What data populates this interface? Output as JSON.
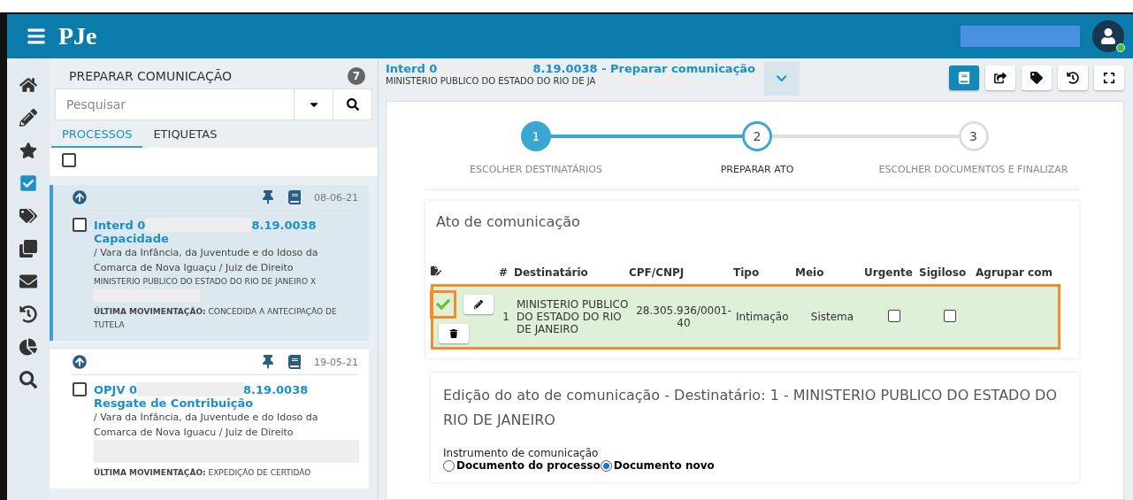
{
  "header": {
    "logo": "PJe"
  },
  "rail": [
    {
      "kind": "home",
      "selected": false
    },
    {
      "kind": "pencil",
      "selected": false
    },
    {
      "kind": "star",
      "selected": false
    },
    {
      "kind": "check",
      "selected": true
    },
    {
      "kind": "tags",
      "selected": false
    },
    {
      "kind": "copy",
      "selected": false
    },
    {
      "kind": "mail",
      "selected": false
    },
    {
      "kind": "history",
      "selected": false
    },
    {
      "kind": "pie",
      "selected": false
    },
    {
      "kind": "search",
      "selected": false
    }
  ],
  "panel": {
    "title": "PREPARAR COMUNICAÇÃO",
    "count": "7",
    "search": {
      "placeholder": "Pesquisar"
    },
    "tabs": [
      {
        "label": "PROCESSOS",
        "selected": true
      },
      {
        "label": "ETIQUETAS",
        "selected": false
      }
    ],
    "select_all_checked": false,
    "cards": [
      {
        "selected": true,
        "checked": false,
        "date": "08-06-21",
        "number_start": "Interd 0",
        "number_end": "8.19.0038",
        "subject": "Capacidade",
        "court": "/ Vara da Infância, da Juventude e do Idoso da Comarca de Nova Iguaçu / Juiz de Direito",
        "parties": "MINISTERIO PUBLICO DO ESTADO DO RIO DE JANEIRO X",
        "move_label": "ÚLTIMA MOVIMENTAÇÃO:",
        "move": "CONCEDIDA A ANTECIPAÇÃO DE TUTELA"
      },
      {
        "selected": false,
        "checked": false,
        "date": "19-05-21",
        "number_start": "OPJV 0",
        "number_end": "8.19.0038",
        "subject": "Resgate de Contribuição",
        "court": "/ Vara da Infância, da Juventude e do Idoso da Comarca de Nova Iguacu / Juiz de Direito",
        "move_label": "ÚLTIMA MOVIMENTAÇÃO:",
        "move": "EXPEDIÇÃO DE CERTIDÃO"
      }
    ]
  },
  "main": {
    "title_start": "Interd 0",
    "title_end": "8.19.0038 - Preparar comunicação",
    "subtitle": "MINISTERIO PUBLICO DO ESTADO DO RIO DE JA",
    "toolbar": [
      {
        "kind": "book",
        "selected": true
      },
      {
        "kind": "share",
        "selected": false
      },
      {
        "kind": "tag",
        "selected": false
      },
      {
        "kind": "history",
        "selected": false
      },
      {
        "kind": "expand",
        "selected": false
      }
    ],
    "steps": [
      {
        "number": "1",
        "label": "ESCOLHER DESTINATÁRIOS",
        "completed": true,
        "current": false
      },
      {
        "number": "2",
        "label": "PREPARAR ATO",
        "completed": false,
        "current": true
      },
      {
        "number": "3",
        "label": "ESCOLHER DOCUMENTOS E FINALIZAR",
        "completed": false,
        "current": false
      }
    ],
    "act": {
      "title": "Ato de comunicação",
      "columns": [
        "#",
        "Destinatário",
        "CPF/CNPJ",
        "Tipo",
        "Meio",
        "Urgente",
        "Sigiloso",
        "Agrupar com"
      ],
      "rows": [
        {
          "confirmed": true,
          "number": "1",
          "recipient": "MINISTERIO PUBLICO DO ESTADO DO RIO DE JANEIRO",
          "document": "28.305.936/0001-40",
          "type": "Intimação",
          "means": "Sistema",
          "urgent": false,
          "secret": false
        }
      ]
    },
    "edit": {
      "title": "Edição do ato de comunicação - Destinatário: 1 - MINISTERIO PUBLICO DO ESTADO DO RIO DE JANEIRO",
      "instrument_label": "Instrumento de comunicação",
      "options": [
        {
          "label": "Documento do processo",
          "selected": false
        },
        {
          "label": "Documento novo",
          "selected": true
        }
      ]
    }
  }
}
